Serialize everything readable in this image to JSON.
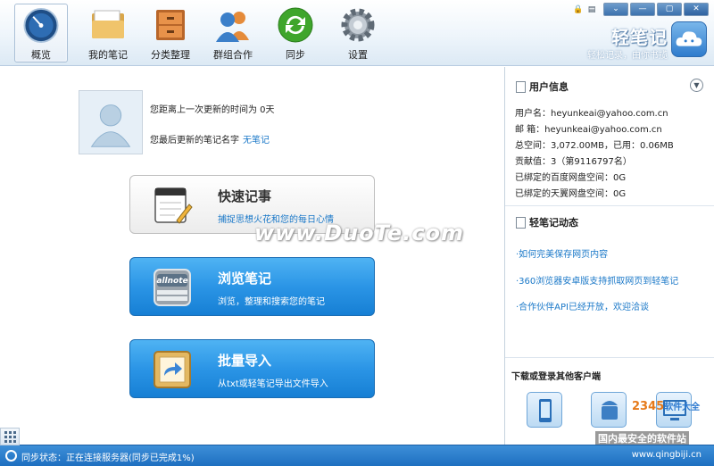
{
  "window": {
    "brand_name": "轻笔记",
    "brand_slogan": "轻松记录，由你书揽",
    "controls": [
      "⌄",
      "—",
      "▢",
      "✕"
    ]
  },
  "toolbar": {
    "items": [
      {
        "label": "概览",
        "icon": "dashboard-icon",
        "active": true
      },
      {
        "label": "我的笔记",
        "icon": "folder-icon"
      },
      {
        "label": "分类整理",
        "icon": "drawer-cabinet-icon"
      },
      {
        "label": "群组合作",
        "icon": "group-users-icon"
      },
      {
        "label": "同步",
        "icon": "sync-icon"
      },
      {
        "label": "设置",
        "icon": "gear-icon"
      }
    ]
  },
  "profile": {
    "last_update_text": "您距离上一次更新的时间为  0天",
    "last_note_prefix": "您最后更新的笔记名字",
    "last_note_name": "无笔记"
  },
  "actions": {
    "quick": {
      "title": "快速记事",
      "subtitle": "捕捉思想火花和您的每日心情",
      "icon": "notepad-pencil-icon"
    },
    "browse": {
      "title": "浏览笔记",
      "subtitle": "浏览，整理和搜索您的笔记",
      "icon": "allnote-icon",
      "icon_text": "allnote"
    },
    "import": {
      "title": "批量导入",
      "subtitle": "从txt或轻笔记导出文件导入",
      "icon": "import-arrow-icon"
    }
  },
  "watermark": "www.DuoTe.com",
  "user_info": {
    "title": "用户信息",
    "lines": [
      "用户名：heyunkeai@yahoo.com.cn",
      "邮    箱：heyunkeai@yahoo.com.cn",
      "总空间：3,072.00MB，已用：0.06MB",
      "贡献值：3（第9116797名）",
      "已绑定的百度网盘空间：0G",
      "已绑定的天翼网盘空间：0G"
    ]
  },
  "news": {
    "title": "轻笔记动态",
    "items": [
      "·如何完美保存网页内容",
      "·360浏览器安卓版支持抓取网页到轻笔记",
      "·合作伙伴API已经开放，欢迎洽谈"
    ]
  },
  "download": {
    "title": "下载或登录其他客户端",
    "logo_num": "2345",
    "logo_text": "软件大全",
    "badge": "国内最安全的软件站"
  },
  "status": {
    "text": "同步状态：正在连接服务器(同步已完成1%)",
    "url": "www.qingbiji.cn"
  }
}
